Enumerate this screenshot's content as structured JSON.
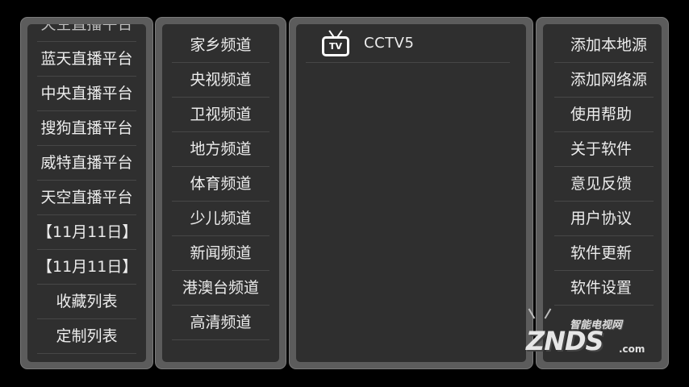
{
  "left_panel": {
    "items": [
      {
        "label": "天空直播平台",
        "partial": true
      },
      {
        "label": "蓝天直播平台"
      },
      {
        "label": "中央直播平台"
      },
      {
        "label": "搜狗直播平台"
      },
      {
        "label": "威特直播平台"
      },
      {
        "label": "天空直播平台"
      },
      {
        "label": "【11月11日】"
      },
      {
        "label": "【11月11日】"
      },
      {
        "label": "收藏列表"
      },
      {
        "label": "定制列表"
      }
    ]
  },
  "category_panel": {
    "items": [
      {
        "label": "家乡频道"
      },
      {
        "label": "央视频道"
      },
      {
        "label": "卫视频道"
      },
      {
        "label": "地方频道"
      },
      {
        "label": "体育频道"
      },
      {
        "label": "少儿频道"
      },
      {
        "label": "新闻频道"
      },
      {
        "label": "港澳台频道"
      },
      {
        "label": "高清频道"
      },
      {
        "label": ""
      }
    ]
  },
  "channel_panel": {
    "channels": [
      {
        "icon": "tv-icon",
        "icon_text": "TV",
        "name": "CCTV5"
      }
    ]
  },
  "settings_panel": {
    "items": [
      {
        "label": "添加本地源"
      },
      {
        "label": "添加网络源"
      },
      {
        "label": "使用帮助"
      },
      {
        "label": "关于软件"
      },
      {
        "label": "意见反馈"
      },
      {
        "label": "用户协议"
      },
      {
        "label": "软件更新"
      },
      {
        "label": "软件设置"
      }
    ]
  },
  "watermark": {
    "subtitle": "智能电视网",
    "brand": "ZNDS",
    "domain": ".com"
  },
  "colors": {
    "background": "#000000",
    "panel_frame": "#5c5c5c",
    "panel_fill": "#2f2f2f",
    "text": "#ececec",
    "divider": "#474747"
  }
}
